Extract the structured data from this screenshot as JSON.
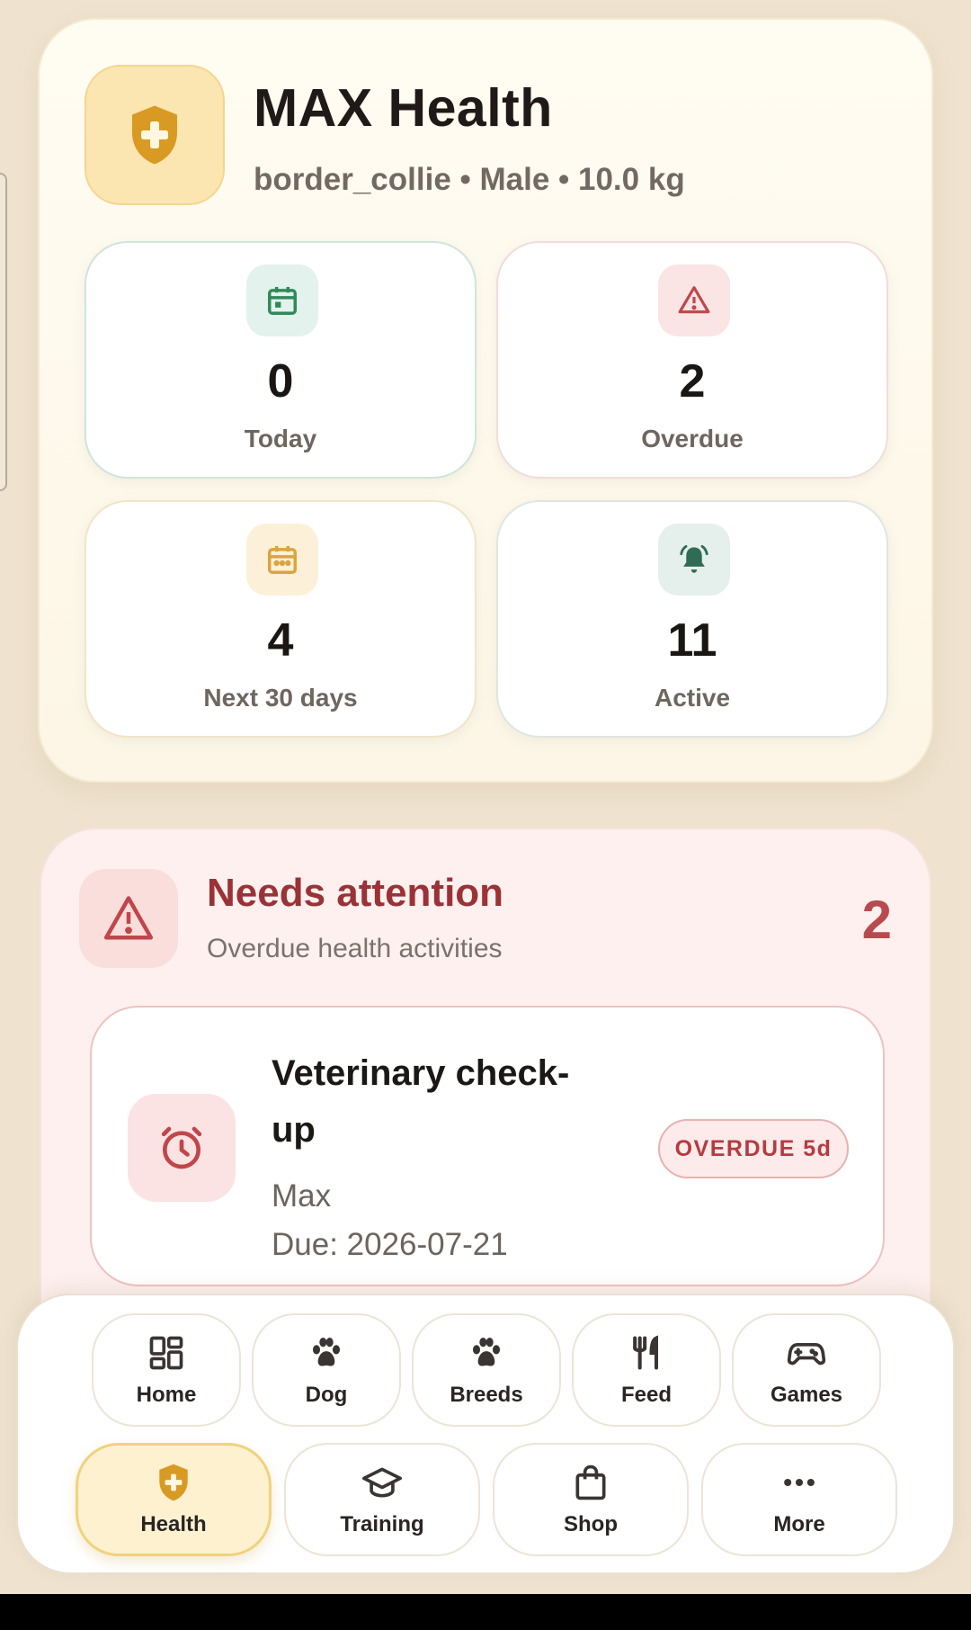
{
  "header": {
    "title": "MAX Health",
    "subtitle": "border_collie • Male • 10.0 kg",
    "icon": "shield-plus-icon",
    "accent": "#f2c14e"
  },
  "stats": [
    {
      "value": "0",
      "label": "Today",
      "icon": "calendar-icon",
      "color": "#2f8a5a"
    },
    {
      "value": "2",
      "label": "Overdue",
      "icon": "warning-icon",
      "color": "#c0464b"
    },
    {
      "value": "4",
      "label": "Next 30 days",
      "icon": "calendar-dots-icon",
      "color": "#d9a540"
    },
    {
      "value": "11",
      "label": "Active",
      "icon": "bell-ring-icon",
      "color": "#2f6b55"
    }
  ],
  "attention": {
    "title": "Needs attention",
    "subtitle": "Overdue health activities",
    "count": "2",
    "items": [
      {
        "title": "Veterinary check-up",
        "pet": "Max",
        "due": "Due: 2026-07-21",
        "badge": "OVERDUE 5d",
        "icon": "alarm-clock-icon"
      }
    ]
  },
  "nav": {
    "row1": [
      {
        "label": "Home",
        "icon": "dashboard-icon"
      },
      {
        "label": "Dog",
        "icon": "paw-icon"
      },
      {
        "label": "Breeds",
        "icon": "paw-icon"
      },
      {
        "label": "Feed",
        "icon": "utensils-icon"
      },
      {
        "label": "Games",
        "icon": "gamepad-icon"
      }
    ],
    "row2": [
      {
        "label": "Health",
        "icon": "shield-plus-icon",
        "active": true
      },
      {
        "label": "Training",
        "icon": "graduation-cap-icon"
      },
      {
        "label": "Shop",
        "icon": "shopping-bag-icon"
      },
      {
        "label": "More",
        "icon": "more-horizontal-icon"
      }
    ]
  }
}
